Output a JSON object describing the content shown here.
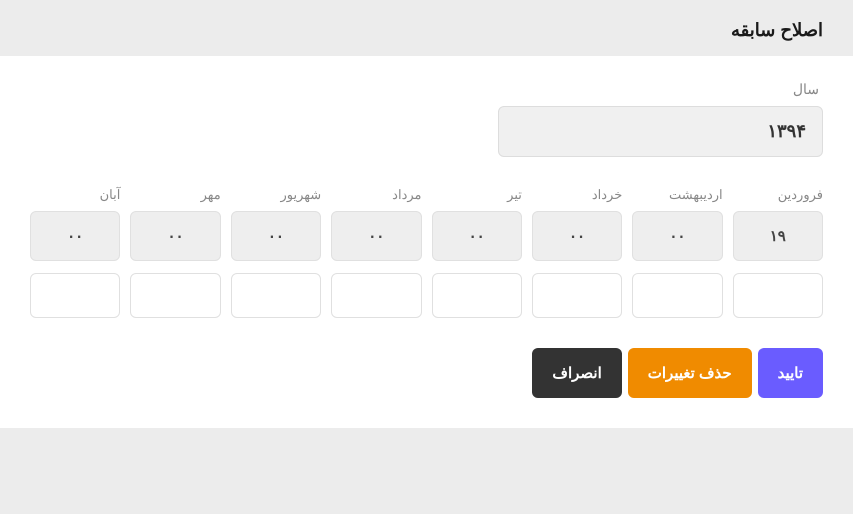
{
  "header": {
    "title": "اصلاح سابقه"
  },
  "year": {
    "label": "سال",
    "value": "۱۳۹۴"
  },
  "months": [
    {
      "label": "فروردین",
      "value": "۱۹"
    },
    {
      "label": "اردیبهشت",
      "value": "۰۰"
    },
    {
      "label": "خرداد",
      "value": "۰۰"
    },
    {
      "label": "تیر",
      "value": "۰۰"
    },
    {
      "label": "مرداد",
      "value": "۰۰"
    },
    {
      "label": "شهریور",
      "value": "۰۰"
    },
    {
      "label": "مهر",
      "value": "۰۰"
    },
    {
      "label": "آبان",
      "value": "۰۰"
    }
  ],
  "row2": [
    "",
    "",
    "",
    "",
    "",
    "",
    "",
    ""
  ],
  "actions": {
    "confirm": "تایید",
    "delete": "حذف تغییرات",
    "cancel": "انصراف"
  },
  "colors": {
    "confirm": "#6a5cff",
    "delete": "#f08b00",
    "cancel": "#333333"
  }
}
